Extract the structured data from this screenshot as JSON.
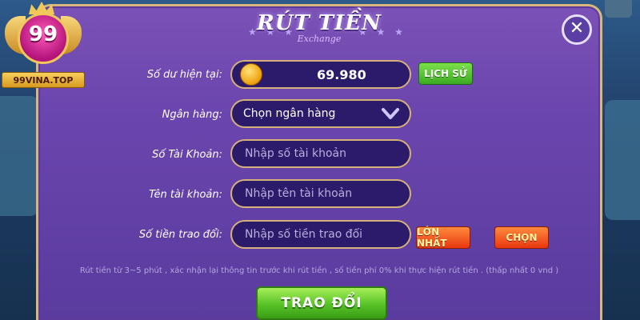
{
  "dialog": {
    "title": "RÚT TIỀN",
    "subtitle": "Exchange",
    "close_symbol": "✕"
  },
  "brand": {
    "logo_number": "99",
    "logo_text": "99VINA.TOP"
  },
  "form": {
    "balance_label": "Số dư hiện tại:",
    "balance_value": "69.980",
    "history_button": "LỊCH SỬ",
    "bank_label": "Ngân hàng:",
    "bank_selected": "Chọn ngân hàng",
    "account_number_label": "Số Tài Khoản:",
    "account_number_placeholder": "Nhập số tài khoản",
    "account_name_label": "Tên tài khoản:",
    "account_name_placeholder": "Nhập tên tài khoản",
    "amount_label": "Số tiền trao đổi:",
    "amount_placeholder": "Nhập số tiền trao đổi",
    "max_button": "LỚN NHẤT",
    "choose_button": "CHỌN"
  },
  "note": "Rút tiền từ 3~5 phút , xác nhận lại thông tin trước khi rút tiền , số tiền phí 0% khi thực hiện rút tiền . (thấp nhất 0 vnd )",
  "submit_button": "TRAO ĐỔI",
  "icons": {
    "coin": "coin-icon",
    "dropdown": "chevron-down-icon",
    "close": "close-icon"
  },
  "colors": {
    "panel": "#6a45ad",
    "field_bg": "#2b1b6a",
    "field_border": "#d6b27a",
    "green_button": "#56c226",
    "orange_button": "#e8370f"
  }
}
